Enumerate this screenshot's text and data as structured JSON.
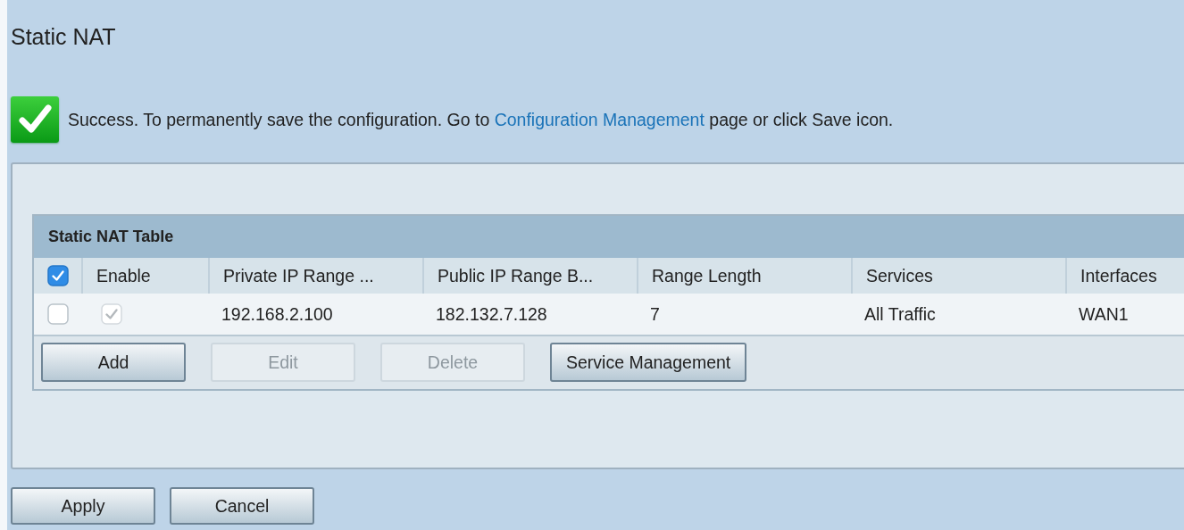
{
  "page": {
    "title": "Static NAT"
  },
  "notice": {
    "kind": "success",
    "text_before": "Success. To permanently save the configuration. Go to ",
    "link": "Configuration Management",
    "text_after": " page or click Save icon."
  },
  "table": {
    "title": "Static NAT Table",
    "select_all": {
      "checked": true
    },
    "columns": [
      "Enable",
      "Private IP Range ...",
      "Public IP Range B...",
      "Range Length",
      "Services",
      "Interfaces"
    ],
    "rows": [
      {
        "selected": false,
        "cells": [
          {
            "kind": "checkbox",
            "checked": true
          },
          "192.168.2.100",
          "182.132.7.128",
          "7",
          "All Traffic",
          "WAN1"
        ]
      }
    ],
    "buttons": [
      {
        "label": "Add",
        "disabled": false
      },
      {
        "label": "Edit",
        "disabled": true
      },
      {
        "label": "Delete",
        "disabled": true
      },
      {
        "label": "Service Management",
        "disabled": false
      }
    ]
  },
  "buttons": [
    {
      "label": "Apply"
    },
    {
      "label": "Cancel"
    }
  ]
}
